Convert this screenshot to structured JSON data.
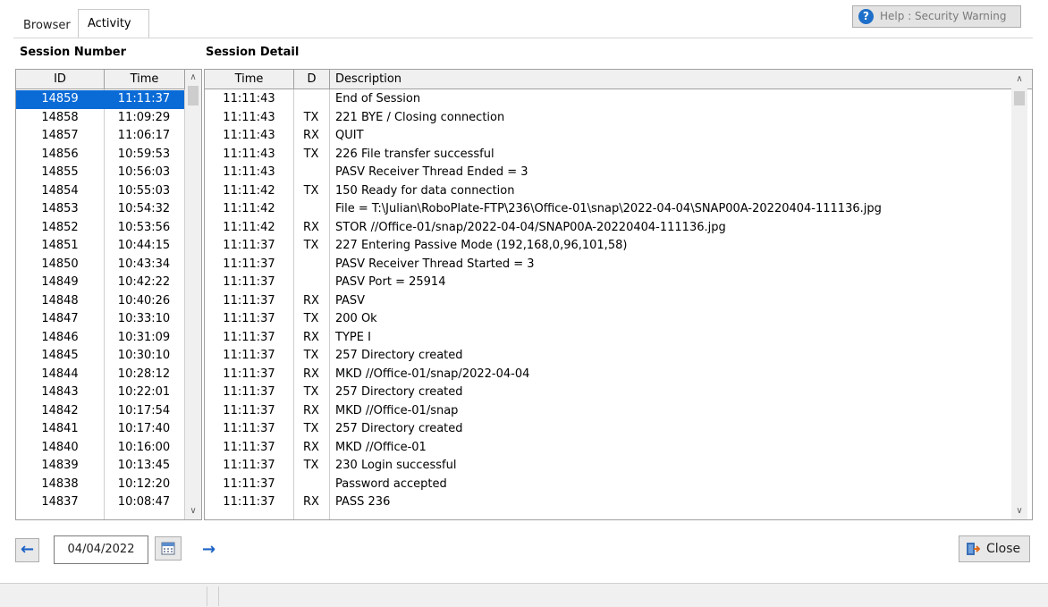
{
  "tabs": [
    {
      "label": "Browser"
    },
    {
      "label": "Activity"
    }
  ],
  "help_button": {
    "label": "Help : Security Warning",
    "icon": "help-circle-icon"
  },
  "session_number": {
    "title": "Session Number",
    "columns": [
      "ID",
      "Time"
    ],
    "rows": [
      [
        "14859",
        "11:11:37"
      ],
      [
        "14858",
        "11:09:29"
      ],
      [
        "14857",
        "11:06:17"
      ],
      [
        "14856",
        "10:59:53"
      ],
      [
        "14855",
        "10:56:03"
      ],
      [
        "14854",
        "10:55:03"
      ],
      [
        "14853",
        "10:54:32"
      ],
      [
        "14852",
        "10:53:56"
      ],
      [
        "14851",
        "10:44:15"
      ],
      [
        "14850",
        "10:43:34"
      ],
      [
        "14849",
        "10:42:22"
      ],
      [
        "14848",
        "10:40:26"
      ],
      [
        "14847",
        "10:33:10"
      ],
      [
        "14846",
        "10:31:09"
      ],
      [
        "14845",
        "10:30:10"
      ],
      [
        "14844",
        "10:28:12"
      ],
      [
        "14843",
        "10:22:01"
      ],
      [
        "14842",
        "10:17:54"
      ],
      [
        "14841",
        "10:17:40"
      ],
      [
        "14840",
        "10:16:00"
      ],
      [
        "14839",
        "10:13:45"
      ],
      [
        "14838",
        "10:12:20"
      ],
      [
        "14837",
        "10:08:47"
      ]
    ],
    "selected_index": 0
  },
  "session_detail": {
    "title": "Session Detail",
    "columns": [
      "Time",
      "D",
      "Description"
    ],
    "rows": [
      [
        "11:11:43",
        "",
        "End of Session"
      ],
      [
        "11:11:43",
        "TX",
        "221 BYE / Closing connection"
      ],
      [
        "11:11:43",
        "RX",
        "QUIT"
      ],
      [
        "11:11:43",
        "TX",
        "226 File transfer successful"
      ],
      [
        "11:11:43",
        "",
        "PASV Receiver Thread Ended = 3"
      ],
      [
        "11:11:42",
        "TX",
        "150 Ready for data connection"
      ],
      [
        "11:11:42",
        "",
        "File = T:\\Julian\\RoboPlate-FTP\\236\\Office-01\\snap\\2022-04-04\\SNAP00A-20220404-111136.jpg"
      ],
      [
        "11:11:42",
        "RX",
        "STOR //Office-01/snap/2022-04-04/SNAP00A-20220404-111136.jpg"
      ],
      [
        "11:11:37",
        "TX",
        "227 Entering Passive Mode (192,168,0,96,101,58)"
      ],
      [
        "11:11:37",
        "",
        "PASV Receiver Thread Started = 3"
      ],
      [
        "11:11:37",
        "",
        "PASV Port = 25914"
      ],
      [
        "11:11:37",
        "RX",
        "PASV"
      ],
      [
        "11:11:37",
        "TX",
        "200 Ok"
      ],
      [
        "11:11:37",
        "RX",
        "TYPE I"
      ],
      [
        "11:11:37",
        "TX",
        "257 Directory created"
      ],
      [
        "11:11:37",
        "RX",
        "MKD //Office-01/snap/2022-04-04"
      ],
      [
        "11:11:37",
        "TX",
        "257 Directory created"
      ],
      [
        "11:11:37",
        "RX",
        "MKD //Office-01/snap"
      ],
      [
        "11:11:37",
        "TX",
        "257 Directory created"
      ],
      [
        "11:11:37",
        "RX",
        "MKD //Office-01"
      ],
      [
        "11:11:37",
        "TX",
        "230 Login successful"
      ],
      [
        "11:11:37",
        "",
        "Password accepted"
      ],
      [
        "11:11:37",
        "RX",
        "PASS 236"
      ]
    ]
  },
  "date_nav": {
    "date": "04/04/2022",
    "prev_icon": "arrow-left-icon",
    "next_icon": "arrow-right-icon",
    "calendar_icon": "calendar-icon"
  },
  "close_button": {
    "label": "Close",
    "icon": "exit-door-icon"
  },
  "colors": {
    "selection": "#0a6bd6",
    "arrow": "#1d63c7",
    "help_icon": "#1e6fc9"
  }
}
